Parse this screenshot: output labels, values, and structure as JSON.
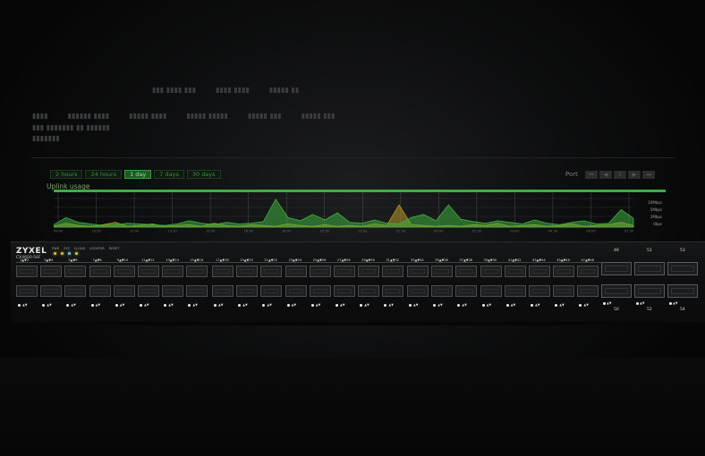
{
  "brand": {
    "name": "ZYXEL",
    "model": "CX4600-56F"
  },
  "panel": {
    "led_labels": [
      "PWR",
      "SYS",
      "CLOUD",
      "LOCATOR"
    ],
    "reset_label": "RESET",
    "led_colors": [
      "#d6c43a",
      "#d6c43a",
      "#6fc0e0",
      "#d6c43a"
    ]
  },
  "dashboard": {
    "tabs": [
      "2 hours",
      "24 hours",
      "1 day",
      "7 days",
      "30 days"
    ],
    "active_tab": "1 day",
    "pager_label": "Port",
    "pager_buttons": [
      "⏮",
      "◀",
      "1",
      "▶",
      "⏭"
    ],
    "chart_title": "Uplink usage"
  },
  "chart_data": {
    "type": "area",
    "title": "Uplink usage",
    "x": [
      "09:00",
      "10:30",
      "12:00",
      "13:30",
      "15:00",
      "16:30",
      "18:00",
      "19:30",
      "21:00",
      "22:30",
      "00:00",
      "01:30",
      "03:00",
      "04:30",
      "06:00",
      "07:30"
    ],
    "y_ticks": [
      "10Mbps",
      "5Mbps",
      "2Mbps",
      "0bps"
    ],
    "series": [
      {
        "color": "#3fae3f",
        "values": [
          0.3,
          1.2,
          0.6,
          0.4,
          0.2,
          0.3,
          0.5,
          0.4,
          0.3,
          0.2,
          0.4,
          0.8,
          0.5,
          0.3,
          0.6,
          0.4,
          0.5,
          0.7,
          3.5,
          1.2,
          0.8,
          1.6,
          0.9,
          1.8,
          0.6,
          0.5,
          0.9,
          0.5,
          0.4,
          1.2,
          1.6,
          0.8,
          2.8,
          1.0,
          0.7,
          0.5,
          0.8,
          0.6,
          0.4,
          0.9,
          0.5,
          0.3,
          0.6,
          0.8,
          0.4,
          0.5,
          2.2,
          1.1
        ]
      },
      {
        "color": "#b89a28",
        "values": [
          0.1,
          0.5,
          0.2,
          0.1,
          0.3,
          0.6,
          0.1,
          0.2,
          0.4,
          0.1,
          0.2,
          0.3,
          0.1,
          0.5,
          0.2,
          0.1,
          0.3,
          0.2,
          0.1,
          0.4,
          0.2,
          0.1,
          0.3,
          0.1,
          0.2,
          0.1,
          0.4,
          0.2,
          2.8,
          0.3,
          0.2,
          0.1,
          0.2,
          0.1,
          0.3,
          0.2,
          0.5,
          0.1,
          0.2,
          0.3,
          0.1,
          0.2,
          0.4,
          0.1,
          0.2,
          0.3,
          0.6,
          0.2
        ]
      }
    ]
  },
  "ports": {
    "sfp_count": 48,
    "qsfp_top": [
      "49",
      "51",
      "53"
    ],
    "qsfp_bottom": [
      "50",
      "52",
      "54"
    ]
  }
}
